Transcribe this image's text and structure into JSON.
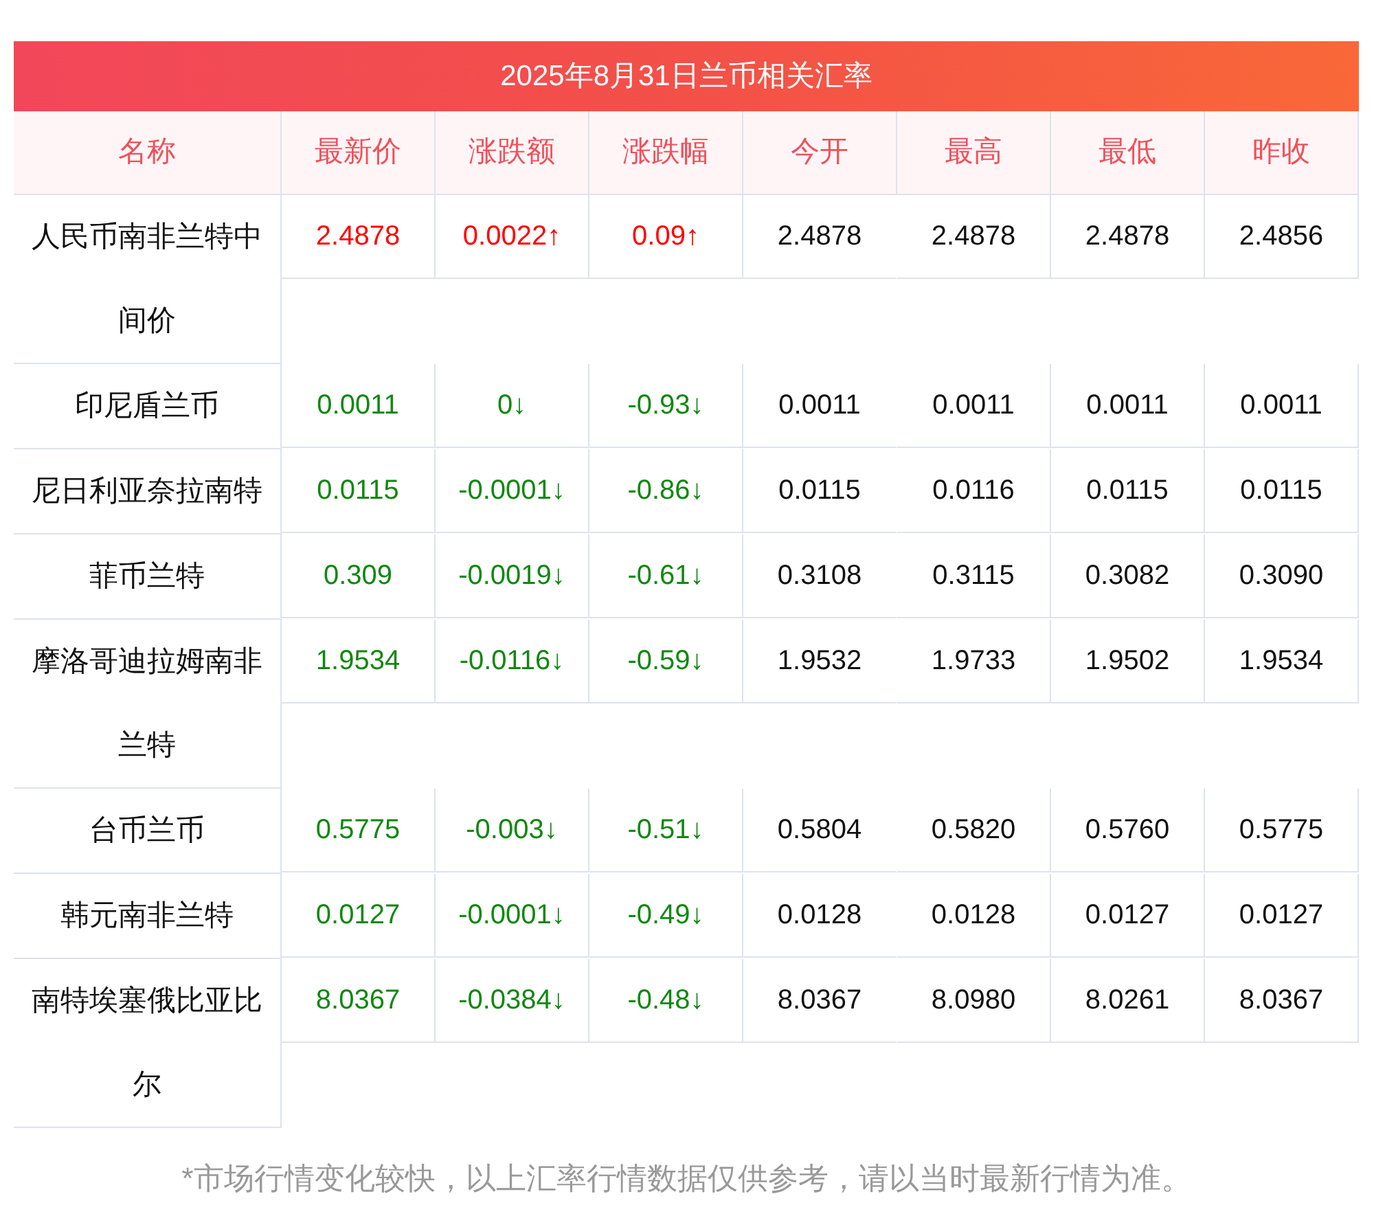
{
  "title": "2025年8月31日兰币相关汇率",
  "columns": [
    "名称",
    "最新价",
    "涨跌额",
    "涨跌幅",
    "今开",
    "最高",
    "最低",
    "昨收"
  ],
  "rows": [
    {
      "name": "人民币南非兰特中间价",
      "rising": true,
      "latest": "2.4878",
      "change": "0.0022↑",
      "pct": "0.09↑",
      "open": "2.4878",
      "high": "2.4878",
      "low": "2.4878",
      "prev": "2.4856"
    },
    {
      "name": "印尼盾兰币",
      "rising": false,
      "latest": "0.0011",
      "change": "0↓",
      "pct": "-0.93↓",
      "open": "0.0011",
      "high": "0.0011",
      "low": "0.0011",
      "prev": "0.0011"
    },
    {
      "name": "尼日利亚奈拉南特",
      "rising": false,
      "latest": "0.0115",
      "change": "-0.0001↓",
      "pct": "-0.86↓",
      "open": "0.0115",
      "high": "0.0116",
      "low": "0.0115",
      "prev": "0.0115"
    },
    {
      "name": "菲币兰特",
      "rising": false,
      "latest": "0.309",
      "change": "-0.0019↓",
      "pct": "-0.61↓",
      "open": "0.3108",
      "high": "0.3115",
      "low": "0.3082",
      "prev": "0.3090"
    },
    {
      "name": "摩洛哥迪拉姆南非兰特",
      "rising": false,
      "latest": "1.9534",
      "change": "-0.0116↓",
      "pct": "-0.59↓",
      "open": "1.9532",
      "high": "1.9733",
      "low": "1.9502",
      "prev": "1.9534"
    },
    {
      "name": "台币兰币",
      "rising": false,
      "latest": "0.5775",
      "change": "-0.003↓",
      "pct": "-0.51↓",
      "open": "0.5804",
      "high": "0.5820",
      "low": "0.5760",
      "prev": "0.5775"
    },
    {
      "name": "韩元南非兰特",
      "rising": false,
      "latest": "0.0127",
      "change": "-0.0001↓",
      "pct": "-0.49↓",
      "open": "0.0128",
      "high": "0.0128",
      "low": "0.0127",
      "prev": "0.0127"
    },
    {
      "name": "南特埃塞俄比亚比尔",
      "rising": false,
      "latest": "8.0367",
      "change": "-0.0384↓",
      "pct": "-0.48↓",
      "open": "8.0367",
      "high": "8.0980",
      "low": "8.0261",
      "prev": "8.0367"
    }
  ],
  "note": "*市场行情变化较快，以上汇率行情数据仅供参考，请以当时最新行情为准。"
}
